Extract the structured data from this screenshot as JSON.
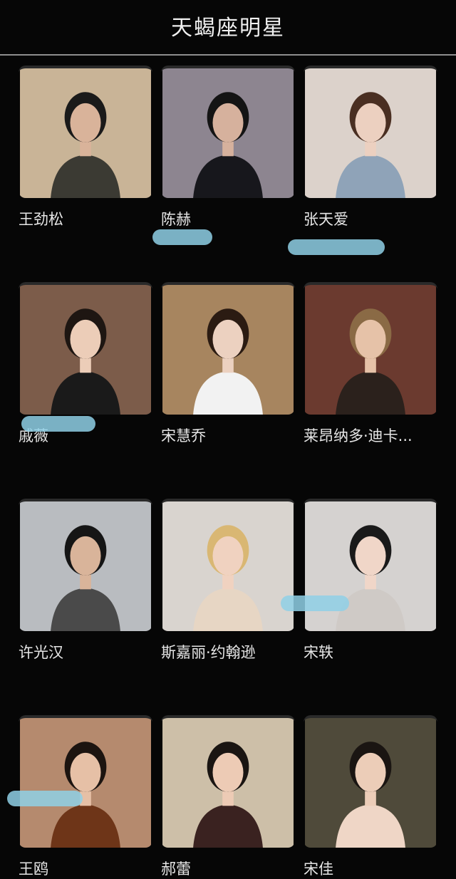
{
  "header": {
    "title": "天蝎座明星"
  },
  "stars": [
    {
      "name": "王劲松",
      "bg": "#c9b497",
      "fg": "#3b3a33",
      "skin": "#d9b39a",
      "hair": "#1a1a1a"
    },
    {
      "name": "陈赫",
      "bg": "#8d8590",
      "fg": "#17171c",
      "skin": "#d6b19d",
      "hair": "#141414"
    },
    {
      "name": "张天爱",
      "bg": "#dcd2cb",
      "fg": "#8fa3b8",
      "skin": "#ecd0c0",
      "hair": "#4a2f22"
    },
    {
      "name": "戚薇",
      "bg": "#7c5c4a",
      "fg": "#1a1a1a",
      "skin": "#eccdb8",
      "hair": "#1e1612"
    },
    {
      "name": "宋慧乔",
      "bg": "#a7855f",
      "fg": "#f2f2f2",
      "skin": "#ecd1c0",
      "hair": "#2b1b12"
    },
    {
      "name": "莱昂纳多·迪卡...",
      "bg": "#6b3a2f",
      "fg": "#2b211c",
      "skin": "#e6c2a8",
      "hair": "#8a6a45"
    },
    {
      "name": "许光汉",
      "bg": "#b9bcc0",
      "fg": "#4a4a4a",
      "skin": "#d9b49a",
      "hair": "#151515"
    },
    {
      "name": "斯嘉丽·约翰逊",
      "bg": "#d9d4cf",
      "fg": "#e7d6c4",
      "skin": "#f0d2c0",
      "hair": "#d9b773"
    },
    {
      "name": "宋轶",
      "bg": "#d5d2d0",
      "fg": "#cfcac6",
      "skin": "#f0d6c8",
      "hair": "#1a1a1a"
    },
    {
      "name": "王鸥",
      "bg": "#b58a6e",
      "fg": "#6e3518",
      "skin": "#e6c0a6",
      "hair": "#1c1410"
    },
    {
      "name": "郝蕾",
      "bg": "#cdbfa8",
      "fg": "#3a2220",
      "skin": "#edcbb5",
      "hair": "#1a1512"
    },
    {
      "name": "宋佳",
      "bg": "#4f4a3a",
      "fg": "#efd6c6",
      "skin": "#eccdb8",
      "hair": "#1a1512"
    }
  ]
}
